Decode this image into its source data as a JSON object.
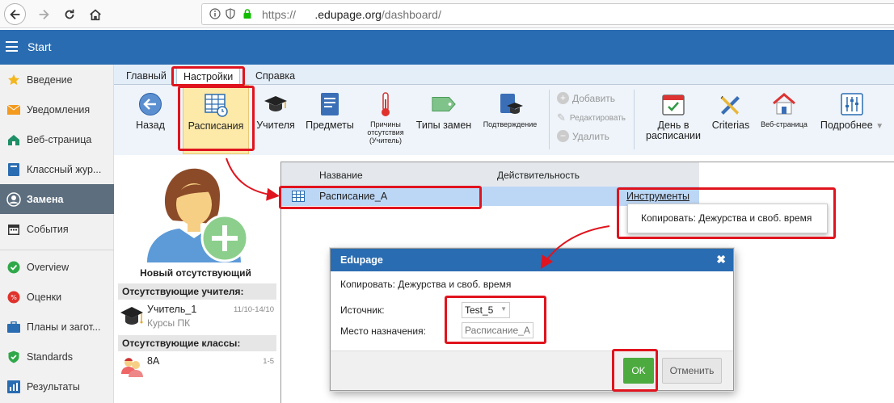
{
  "browser": {
    "url_prefix": "https://",
    "url_domain": ".edupage.org",
    "url_path": "/dashboard/"
  },
  "appbar": {
    "title": "Start"
  },
  "sidebar": {
    "items": [
      {
        "label": "Введение",
        "icon": "star-icon"
      },
      {
        "label": "Уведомления",
        "icon": "envelope-icon"
      },
      {
        "label": "Веб-страница",
        "icon": "house-icon"
      },
      {
        "label": "Классный жур...",
        "icon": "book-icon"
      },
      {
        "label": "Замена",
        "icon": "user-circle-icon"
      },
      {
        "label": "События",
        "icon": "calendar-icon"
      },
      {
        "label": "Overview",
        "icon": "check-circle-icon"
      },
      {
        "label": "Оценки",
        "icon": "grade-icon"
      },
      {
        "label": "Планы и загот...",
        "icon": "briefcase-icon"
      },
      {
        "label": "Standards",
        "icon": "shield-icon"
      },
      {
        "label": "Результаты",
        "icon": "chart-icon"
      }
    ]
  },
  "ribbon": {
    "tabs": [
      "Главный",
      "Настройки",
      "Справка"
    ],
    "buttons": {
      "back": "Назад",
      "timetables": "Расписания",
      "teachers": "Учителя",
      "subjects": "Предметы",
      "absence_reasons_1": "Причины",
      "absence_reasons_2": "отсутствия",
      "absence_reasons_3": "(Учитель)",
      "sub_types": "Типы замен",
      "confirmation": "Подтверждение",
      "add": "Добавить",
      "edit": "Редактировать",
      "delete": "Удалить",
      "day_in_tt_1": "День в",
      "day_in_tt_2": "расписании",
      "criterias": "Criterias",
      "webpage": "Веб-страница",
      "more": "Подробнее"
    }
  },
  "absence": {
    "new_absent": "Новый отсутствующий",
    "absent_teachers": "Отсутствующие учителя:",
    "teacher_name": "Учитель_1",
    "teacher_sub": "Курсы ПК",
    "teacher_dates": "11/10-14/10",
    "absent_classes": "Отсутствующие классы:",
    "class_name": "8А",
    "class_periods": "1-5"
  },
  "grid": {
    "col_name": "Название",
    "col_validity": "Действительность",
    "row_name": "Расписание_А",
    "row_tools": "Инструменты"
  },
  "context_menu": {
    "item": "Копировать: Дежурства и своб. время"
  },
  "dialog": {
    "title": "Edupage",
    "close": "✖",
    "description": "Копировать: Дежурства и своб. время",
    "source_label": "Источник:",
    "source_value": "Test_5",
    "dest_label": "Место назначения:",
    "dest_value": "Расписание_А",
    "ok": "OK",
    "cancel": "Отменить"
  },
  "colors": {
    "brand_blue": "#2a6cb1",
    "annotation_red": "#e0141e",
    "ok_green": "#4caa3f",
    "selected_row": "#bcd6f5"
  }
}
